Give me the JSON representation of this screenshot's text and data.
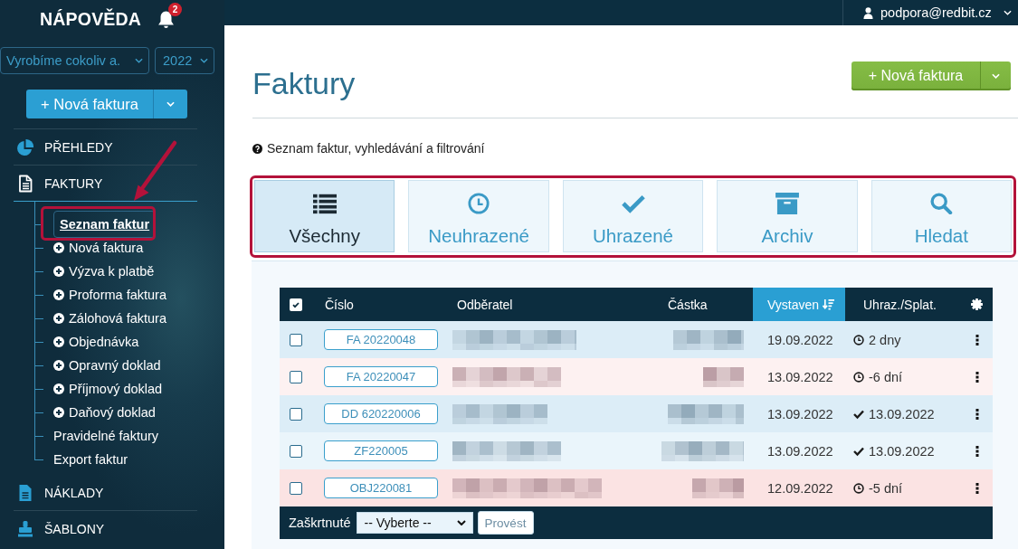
{
  "sidebar": {
    "title": "NÁPOVĚDA",
    "notification_count": "2",
    "company_select": "Vyrobíme cokoliv a.",
    "year_select": "2022",
    "new_button": "+ Nová faktura",
    "sections": [
      {
        "label": "PŘEHLEDY",
        "expanded": false
      },
      {
        "label": "FAKTURY",
        "expanded": true,
        "children": [
          {
            "label": "Seznam faktur",
            "kind": "link",
            "selected": true
          },
          {
            "label": "Nová faktura",
            "kind": "add",
            "selected": false
          },
          {
            "label": "Výzva k platbě",
            "kind": "add",
            "selected": false
          },
          {
            "label": "Proforma faktura",
            "kind": "add",
            "selected": false
          },
          {
            "label": "Zálohová faktura",
            "kind": "add",
            "selected": false
          },
          {
            "label": "Objednávka",
            "kind": "add",
            "selected": false
          },
          {
            "label": "Opravný doklad",
            "kind": "add",
            "selected": false
          },
          {
            "label": "Příjmový doklad",
            "kind": "add",
            "selected": false
          },
          {
            "label": "Daňový doklad",
            "kind": "add",
            "selected": false
          },
          {
            "label": "Pravidelné faktury",
            "kind": "link",
            "selected": false
          },
          {
            "label": "Export faktur",
            "kind": "link",
            "selected": false
          }
        ]
      },
      {
        "label": "NÁKLADY",
        "expanded": false
      },
      {
        "label": "ŠABLONY",
        "expanded": false
      }
    ]
  },
  "top_bar": {
    "user": "podpora@redbit.cz"
  },
  "page": {
    "title": "Faktury",
    "new_button": "+ Nová faktura",
    "help": "Seznam faktur, vyhledávání a filtrování"
  },
  "tabs": [
    {
      "label": "Všechny",
      "selected": true
    },
    {
      "label": "Neuhrazené",
      "selected": false
    },
    {
      "label": "Uhrazené",
      "selected": false
    },
    {
      "label": "Archiv",
      "selected": false
    },
    {
      "label": "Hledat",
      "selected": false
    }
  ],
  "table": {
    "select_all_checked": true,
    "columns": [
      {
        "label": "Číslo",
        "sorted": false
      },
      {
        "label": "Odběratel",
        "sorted": false
      },
      {
        "label": "Částka",
        "sorted": false
      },
      {
        "label": "Vystaven",
        "sorted": true
      },
      {
        "label": "Uhraz./Splat.",
        "sorted": false
      }
    ],
    "rows": [
      {
        "checked": false,
        "number": "FA 20220048",
        "issued": "19.09.2022",
        "due": "2 dny",
        "paid": false,
        "overdue": false
      },
      {
        "checked": false,
        "number": "FA 20220047",
        "issued": "13.09.2022",
        "due": "-6 dní",
        "paid": false,
        "overdue": true
      },
      {
        "checked": false,
        "number": "DD 620220006",
        "issued": "13.09.2022",
        "due": "13.09.2022",
        "paid": true,
        "overdue": false
      },
      {
        "checked": false,
        "number": "ZF220005",
        "issued": "13.09.2022",
        "due": "13.09.2022",
        "paid": true,
        "overdue": false
      },
      {
        "checked": false,
        "number": "OBJ220081",
        "issued": "12.09.2022",
        "due": "-5 dní",
        "paid": false,
        "overdue": true
      }
    ],
    "footer": {
      "label": "Zaškrtnuté",
      "select": "-- Vyberte --",
      "button": "Provést"
    }
  }
}
